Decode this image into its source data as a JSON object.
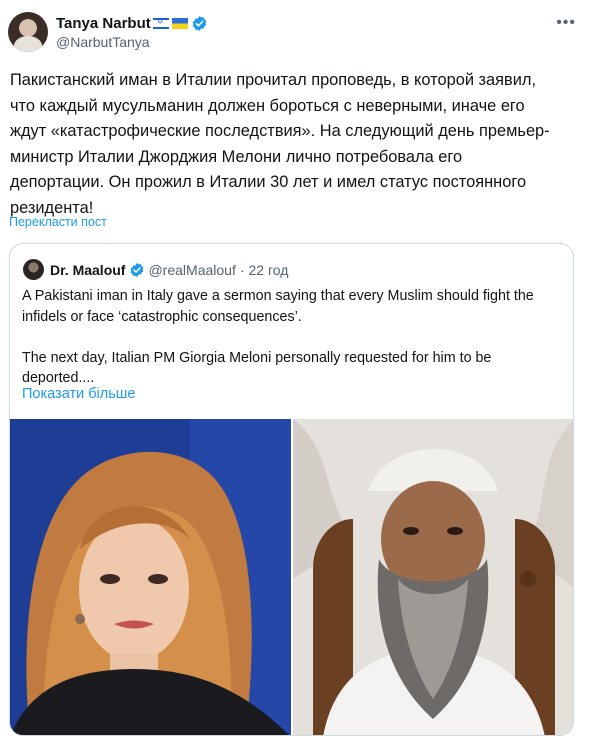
{
  "author": {
    "display_name": "Tanya Narbut",
    "handle": "@NarbutTanya",
    "avatar_icon": "profile-photo"
  },
  "more_icon": "more-horizontal-icon",
  "tweet": {
    "text": "Пакистанский иман в Италии прочитал проповедь, в которой заявил,\nчто каждый мусульманин должен бороться с неверными, иначе его\nждут «катастрофические последствия».  На следующий день премьер-\nминистр Италии Джорджия Мелони лично потребовала его\nдепортации.  Он прожил в Италии 30 лет и имел статус постоянного\nрезидента!",
    "translate_label": "Перекласти пост"
  },
  "quote": {
    "display_name": "Dr. Maalouf",
    "handle": "@realMaalouf",
    "separator": "·",
    "time": "22 год",
    "text": "A Pakistani iman in Italy gave a sermon saying that every Muslim should fight the\ninfidels or face ‘catastrophic consequences’.\n\nThe next day, Italian PM Giorgia Meloni personally requested for him to be\ndeported....",
    "show_more_label": "Показати більше"
  },
  "colors": {
    "accent": "#1d9bf0",
    "text": "#0f1419",
    "secondary": "#536471",
    "border": "#cfd9de"
  }
}
